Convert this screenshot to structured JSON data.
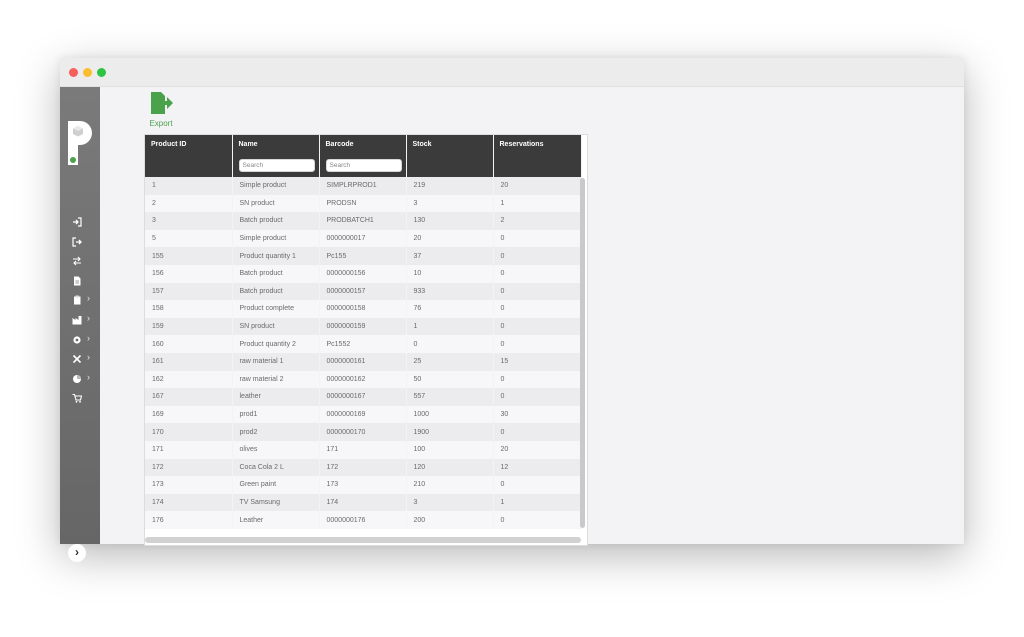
{
  "toolbar": {
    "export_label": "Export"
  },
  "table": {
    "columns": [
      "Product ID",
      "Name",
      "Barcode",
      "Stock",
      "Reservations"
    ],
    "search_placeholder": "Search",
    "rows": [
      [
        "1",
        "Simple product",
        "SIMPLRPROD1",
        "219",
        "20"
      ],
      [
        "2",
        "SN product",
        "PRODSN",
        "3",
        "1"
      ],
      [
        "3",
        "Batch product",
        "PRODBATCH1",
        "130",
        "2"
      ],
      [
        "5",
        "Simple product",
        "0000000017",
        "20",
        "0"
      ],
      [
        "155",
        "Product quantity 1",
        "Pc155",
        "37",
        "0"
      ],
      [
        "156",
        "Batch product",
        "0000000156",
        "10",
        "0"
      ],
      [
        "157",
        "Batch product",
        "0000000157",
        "933",
        "0"
      ],
      [
        "158",
        "Product complete",
        "0000000158",
        "76",
        "0"
      ],
      [
        "159",
        "SN product",
        "0000000159",
        "1",
        "0"
      ],
      [
        "160",
        "Product quantity 2",
        "Pc1552",
        "0",
        "0"
      ],
      [
        "161",
        "raw material 1",
        "0000000161",
        "25",
        "15"
      ],
      [
        "162",
        "raw material 2",
        "0000000162",
        "50",
        "0"
      ],
      [
        "167",
        "leather",
        "0000000167",
        "557",
        "0"
      ],
      [
        "169",
        "prod1",
        "0000000169",
        "1000",
        "30"
      ],
      [
        "170",
        "prod2",
        "0000000170",
        "1900",
        "0"
      ],
      [
        "171",
        "olives",
        "171",
        "100",
        "20"
      ],
      [
        "172",
        "Coca Cola 2 L",
        "172",
        "120",
        "12"
      ],
      [
        "173",
        "Green paint",
        "173",
        "210",
        "0"
      ],
      [
        "174",
        "TV Samsung",
        "174",
        "3",
        "1"
      ],
      [
        "176",
        "Leather",
        "0000000176",
        "200",
        "0"
      ]
    ]
  },
  "sidebar": {
    "items": [
      {
        "icon": "sign-in-icon",
        "has_submenu": false
      },
      {
        "icon": "sign-out-icon",
        "has_submenu": false
      },
      {
        "icon": "transfer-icon",
        "has_submenu": false
      },
      {
        "icon": "document-icon",
        "has_submenu": false
      },
      {
        "icon": "clipboard-icon",
        "has_submenu": true
      },
      {
        "icon": "factory-icon",
        "has_submenu": true
      },
      {
        "icon": "gear-icon",
        "has_submenu": true
      },
      {
        "icon": "tools-icon",
        "has_submenu": true
      },
      {
        "icon": "chart-icon",
        "has_submenu": true
      },
      {
        "icon": "cart-icon",
        "has_submenu": false
      }
    ],
    "chevron": "›",
    "expand_glyph": "›"
  },
  "colors": {
    "header_bg": "#3b3b3b",
    "sidebar_bg": "#707070",
    "accent": "#4aa24a"
  }
}
